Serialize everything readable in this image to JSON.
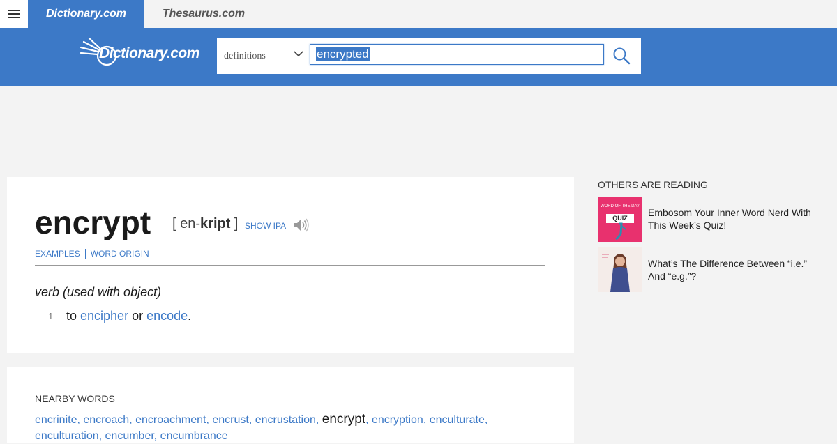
{
  "topbar": {
    "tabs": [
      {
        "label": "Dictionary.com"
      },
      {
        "label": "Thesaurus.com"
      }
    ]
  },
  "header": {
    "logo_text": "Dictionary.com",
    "search": {
      "mode_selected": "definitions",
      "query": "encrypted"
    }
  },
  "entry": {
    "headword": "encrypt",
    "pronunciation": {
      "open": "[ en-",
      "stressed": "kript",
      "close": " ]"
    },
    "show_ipa_label": "SHOW IPA",
    "sublinks": [
      "EXAMPLES",
      "WORD ORIGIN"
    ],
    "part_of_speech": "verb (used with object)",
    "definitions": [
      {
        "number": "1",
        "prefix": "to ",
        "link1": "encipher",
        "middle": " or ",
        "link2": "encode",
        "suffix": "."
      }
    ]
  },
  "nearby": {
    "title": "NEARBY WORDS",
    "words": [
      "encrinite",
      "encroach",
      "encroachment",
      "encrust",
      "encrustation",
      "encrypt",
      "encryption",
      "enculturate",
      "enculturation",
      "encumber",
      "encumbrance"
    ],
    "current": "encrypt"
  },
  "sidebar": {
    "title": "OTHERS ARE READING",
    "items": [
      {
        "title": "Embosom Your Inner Word Nerd With This Week’s Quiz!",
        "thumb_text_top": "WORD OF THE DAY",
        "thumb_text_badge": "QUIZ"
      },
      {
        "title": "What’s The Difference Between “i.e.” And “e.g.”?"
      }
    ]
  },
  "colors": {
    "brand_blue": "#3c79c7",
    "link_blue": "#3c79c7",
    "quiz_pink": "#e8316e"
  }
}
